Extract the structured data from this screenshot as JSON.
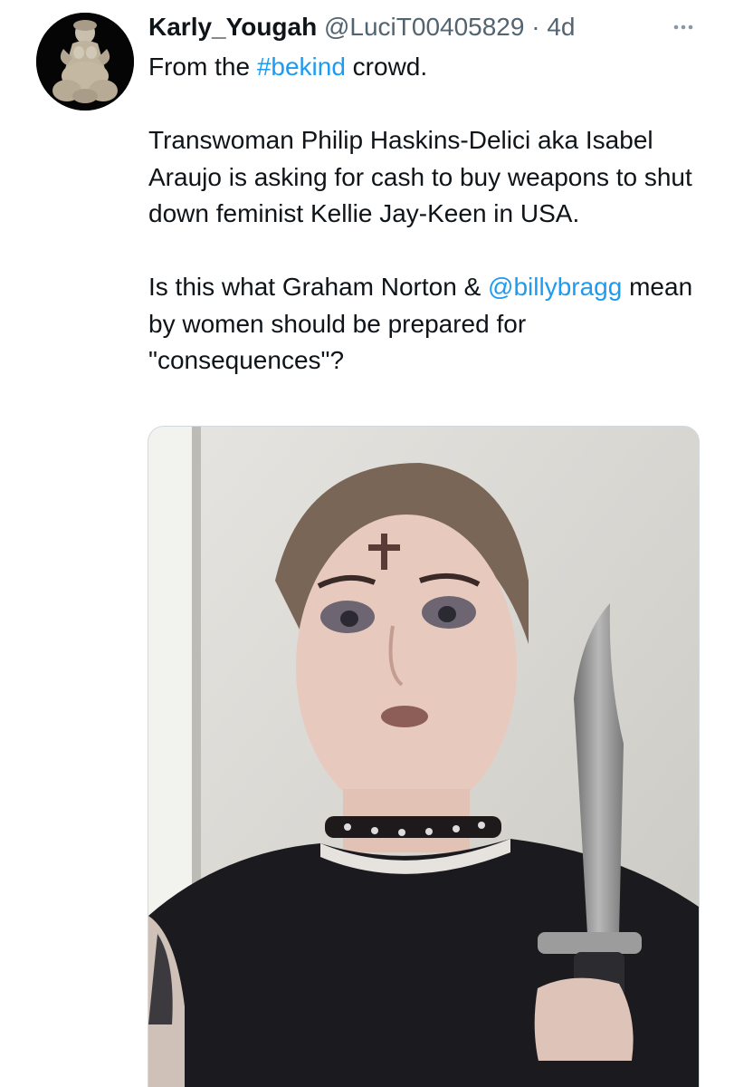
{
  "tweet": {
    "author": {
      "display_name": "Karly_Yougah",
      "handle": "@LuciT00405829",
      "separator": "·",
      "time_ago": "4d"
    },
    "more_icon": "more-horizontal-icon",
    "text": {
      "p1_before": "From the ",
      "p1_hashtag": "#bekind",
      "p1_after": " crowd.",
      "p2": "Transwoman Philip Haskins-Delici aka Isabel Araujo is asking for cash to buy weapons to shut down feminist Kellie Jay-Keen in USA.",
      "p3_before": "Is this what Graham Norton & ",
      "p3_mention": "@billybragg",
      "p3_after": " mean by women should be prepared for \"consequences\"?"
    }
  },
  "colors": {
    "text_primary": "#0f1419",
    "text_secondary": "#536471",
    "link": "#1d9bf0",
    "media_border": "#cfd9de"
  }
}
